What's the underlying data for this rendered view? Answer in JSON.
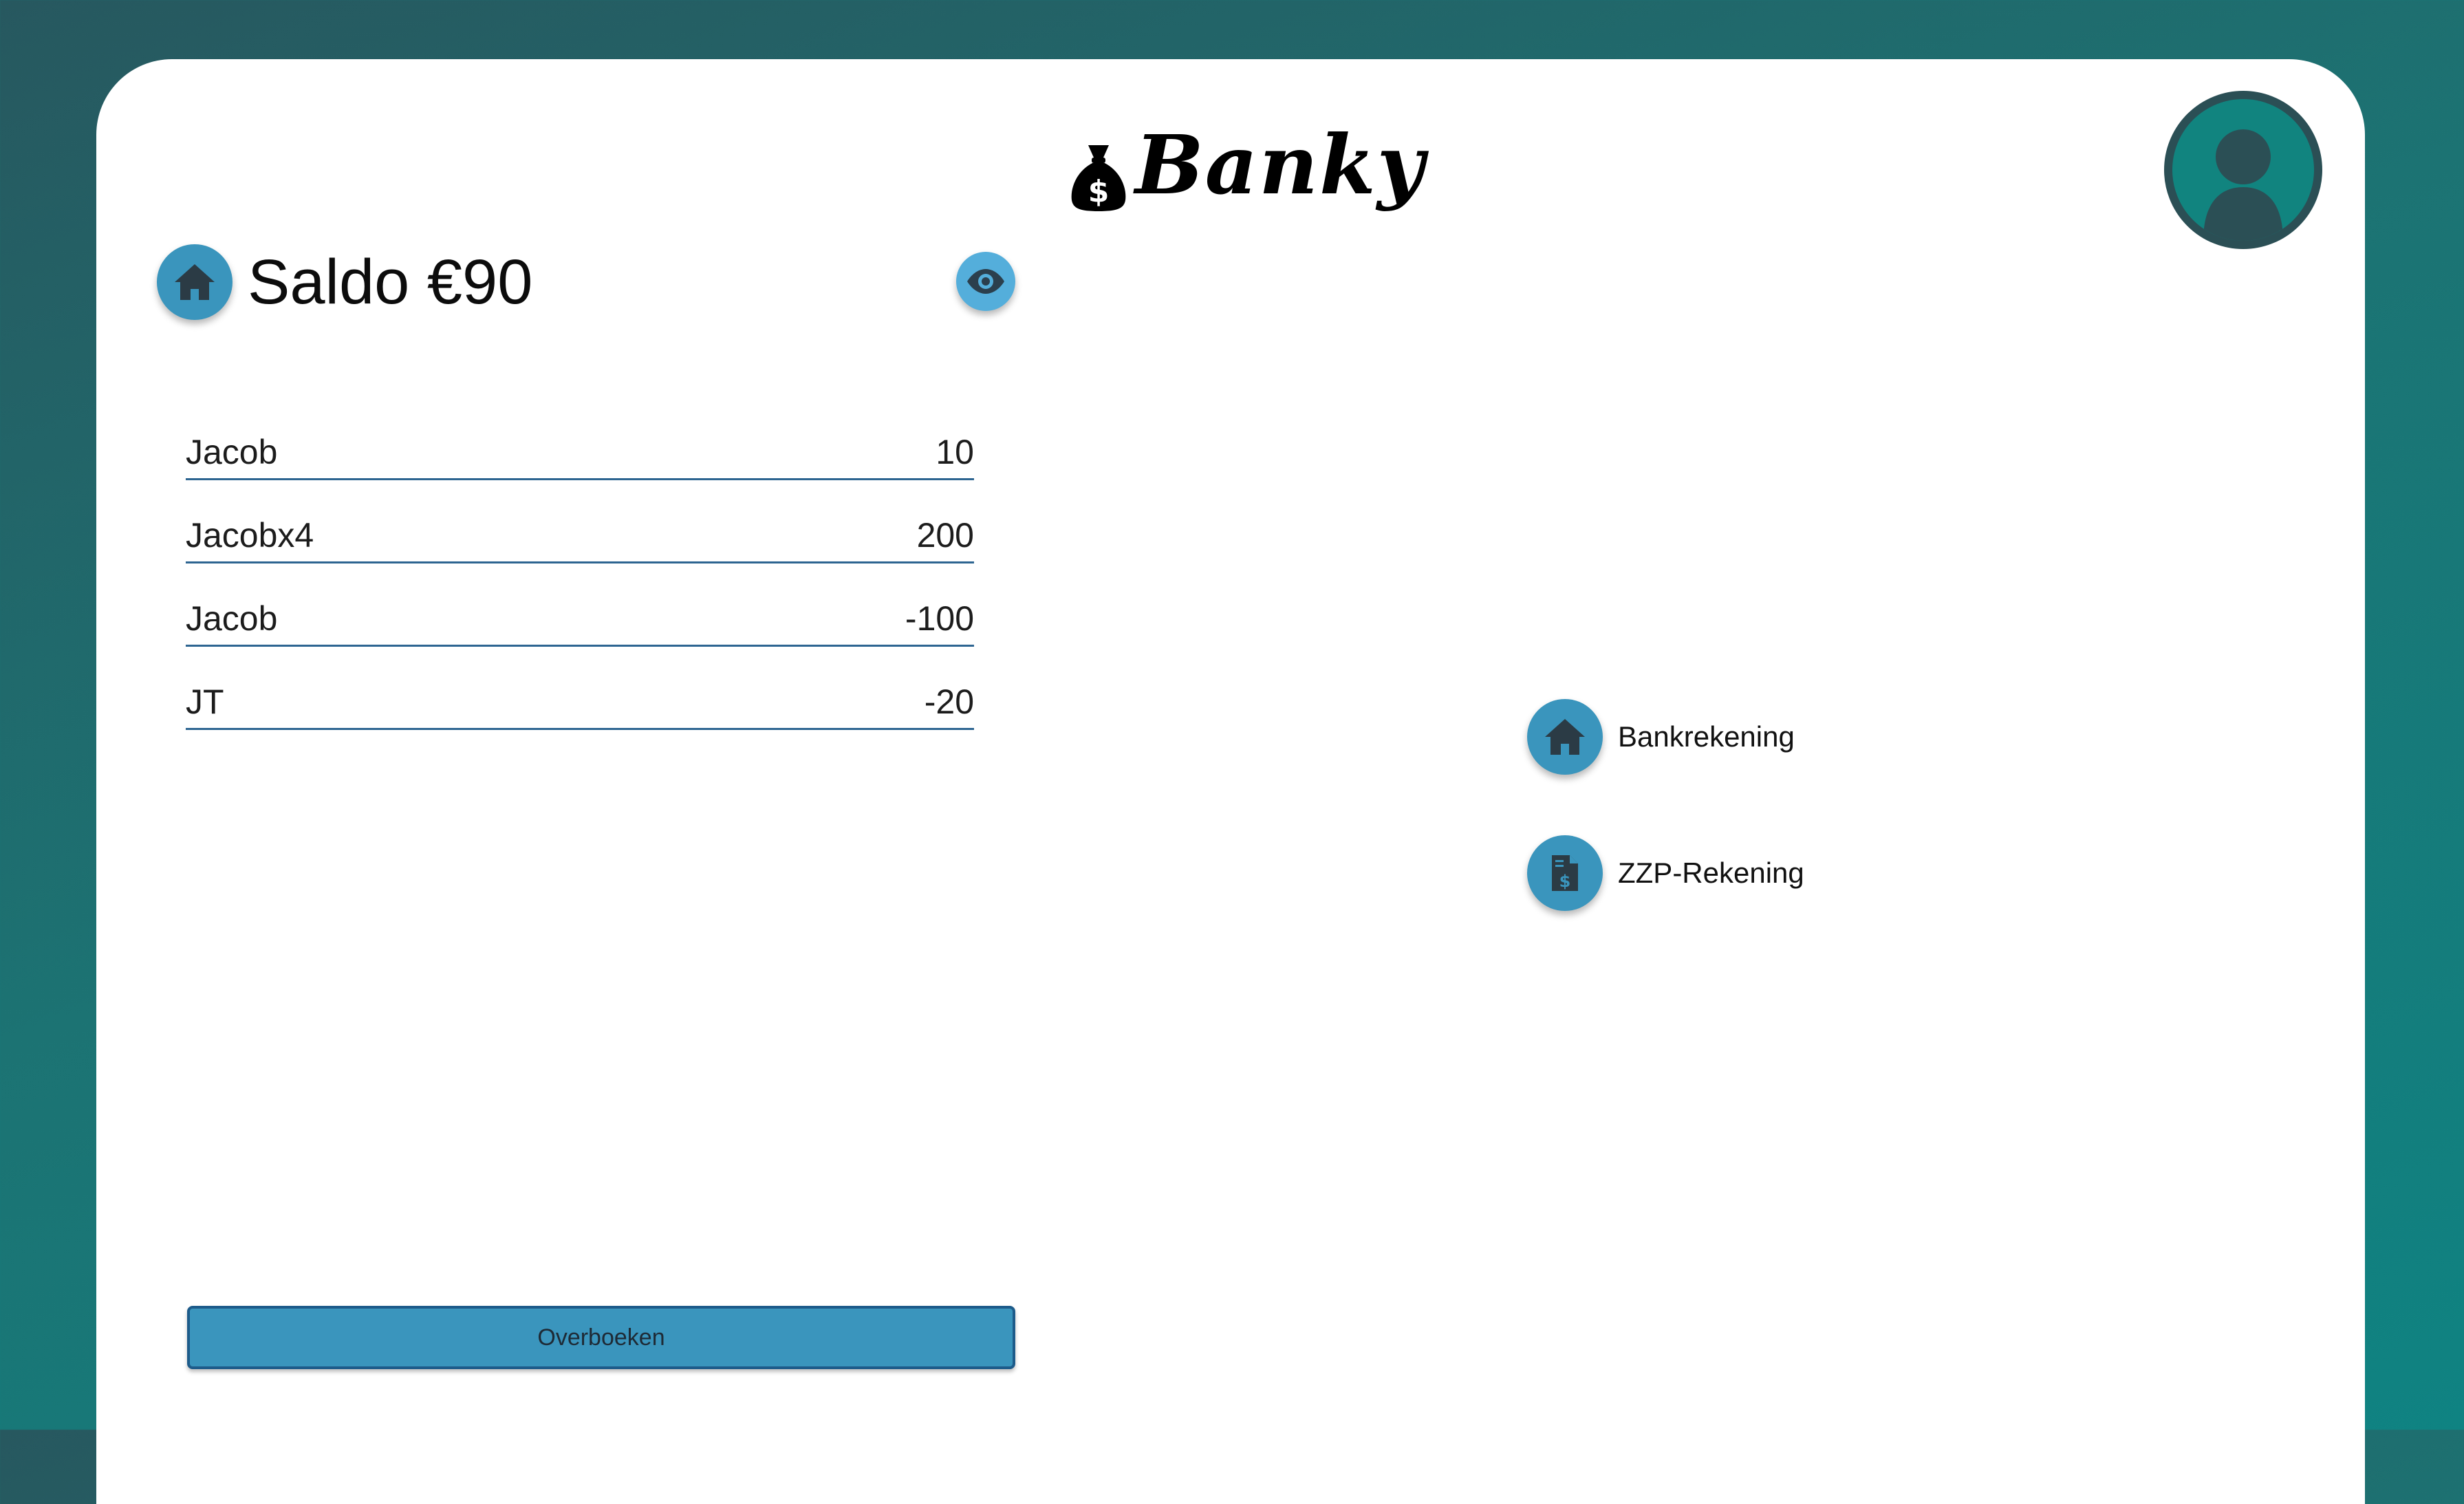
{
  "app": {
    "name": "Banky"
  },
  "balance": {
    "label": "Saldo €90"
  },
  "transactions": [
    {
      "name": "Jacob",
      "amount": "10"
    },
    {
      "name": "Jacobx4",
      "amount": "200"
    },
    {
      "name": "Jacob",
      "amount": "-100"
    },
    {
      "name": "JT",
      "amount": "-20"
    }
  ],
  "accounts": [
    {
      "label": "Bankrekening",
      "icon": "home-icon"
    },
    {
      "label": "ZZP-Rekening",
      "icon": "invoice-dollar-icon"
    }
  ],
  "actions": {
    "transfer_label": "Overboeken"
  },
  "icons": {
    "logo": "money-bag-icon",
    "balance": "home-icon",
    "visibility": "eye-icon",
    "profile": "user-avatar-icon"
  },
  "colors": {
    "background_start": "#27585f",
    "background_end": "#0f8382",
    "accent": "#3a95bd",
    "accent_light": "#54aedb",
    "icon_dark": "#2b4550",
    "divider": "#2d6591",
    "avatar_bg": "#11847f",
    "avatar_ring": "#2b4f55"
  }
}
